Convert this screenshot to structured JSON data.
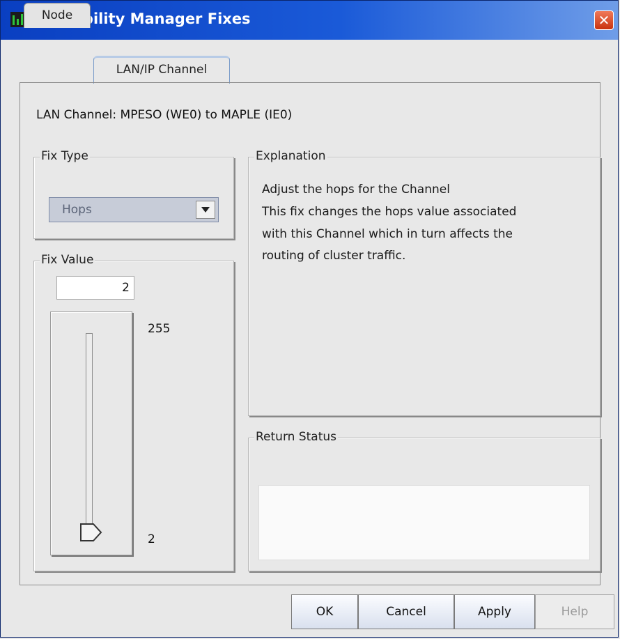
{
  "window": {
    "title": "Availability Manager Fixes",
    "close_glyph": "✕"
  },
  "tabs": [
    {
      "label": "Node",
      "active": false
    },
    {
      "label": "LAN/IP Channel",
      "active": true
    }
  ],
  "channel_label": "LAN Channel: MPESO  (WE0) to MAPLE  (IE0)",
  "fix_type": {
    "label": "Fix Type",
    "selected": "Hops"
  },
  "fix_value": {
    "label": "Fix Value",
    "value": "2",
    "max_label": "255",
    "min_label": "2",
    "slider": {
      "min": 2,
      "max": 255,
      "value": 2
    }
  },
  "explanation": {
    "label": "Explanation",
    "heading": "Adjust the hops for the Channel",
    "lines": [
      "This fix changes the hops value associated",
      "with this Channel which in turn affects the",
      "routing of cluster traffic."
    ]
  },
  "return_status": {
    "label": "Return Status",
    "value": ""
  },
  "buttons": {
    "ok": "OK",
    "cancel": "Cancel",
    "apply": "Apply",
    "help": "Help"
  },
  "colors": {
    "title_bar": "#1a5ad8",
    "close_button": "#d9441e",
    "tab_active_border": "#7a9cc9"
  }
}
